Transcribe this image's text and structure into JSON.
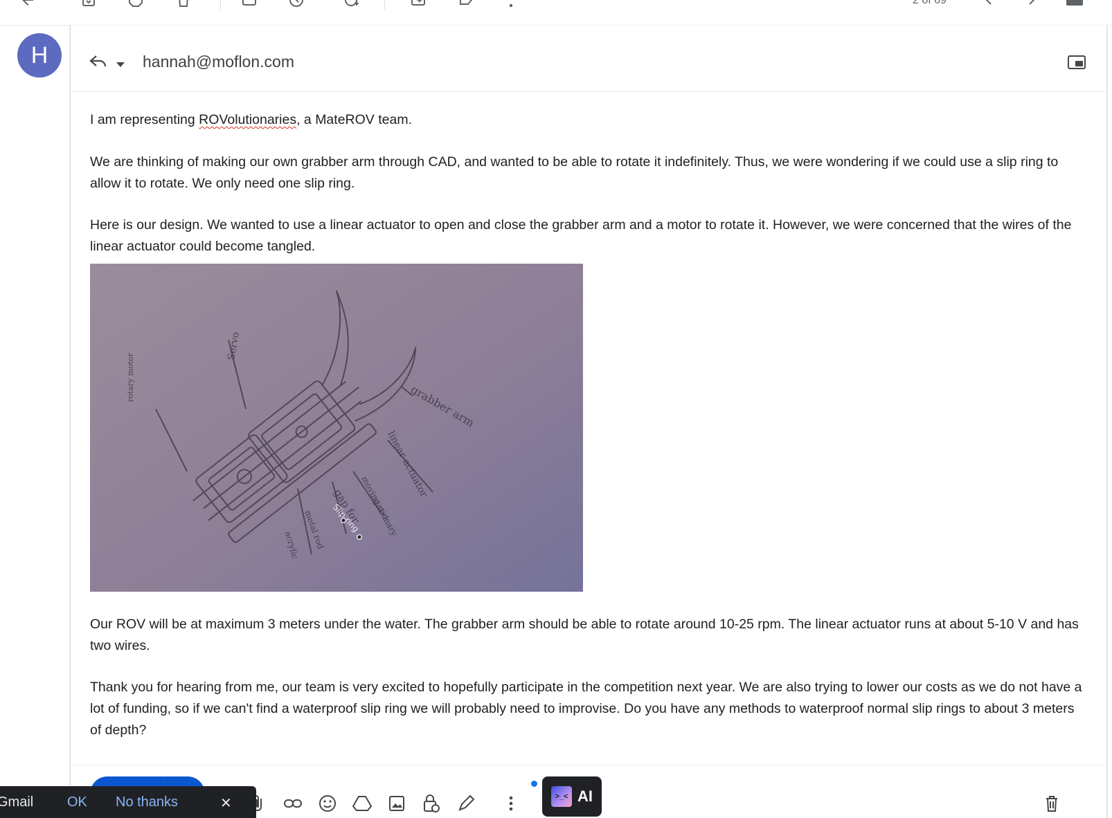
{
  "toolbar": {
    "pager_text": "2 of 69"
  },
  "sender": {
    "avatar_letter": "H"
  },
  "compose": {
    "recipient": "hannah@moflon.com",
    "p1_before": "I am representing ",
    "p1_misspelled": "ROVolutionaries",
    "p1_after": ", a MateROV team.",
    "p2": "We are thinking of making our own grabber arm through CAD, and wanted to be able to rotate it indefinitely. Thus, we were wondering if we could use a slip ring to allow it to rotate. We only need one slip ring.",
    "p3": "Here is our design. We wanted to use a linear actuator to open and close the grabber arm and a motor to rotate it. However, we were concerned that the wires of the linear actuator could become tangled.",
    "p4": "Our ROV will be at maximum 3 meters under the water. The grabber arm should be able to rotate around 10-25 rpm. The linear actuator runs at about 5-10 V and has two wires.",
    "p5": "Thank you for hearing from me, our team is very excited to hopefully participate in the competition next year. We are also trying to lower our costs as we do not have a lot of funding, so if we can't find a waterproof slip ring we will probably need to improvise. Do you have any methods to waterproof normal slip rings to about 3 meters of depth?",
    "sketch_labels": {
      "grabber": "grabber arm",
      "actuator": "linear actuator",
      "moving_rod": "moving rod",
      "stationary": "stationary",
      "gap": "gap for",
      "slip_ring": "Slip ring",
      "metal_rod": "metal rod",
      "acrylic": "acrylic",
      "servo": "Servo",
      "rotary_motor": "rotary motor"
    }
  },
  "footer": {
    "ai_label": "AI",
    "ai_logo_text": ">_<"
  },
  "snackbar": {
    "text": "Gmail",
    "ok": "OK",
    "no_thanks": "No thanks",
    "close": "✕"
  },
  "colors": {
    "accent": "#0b57d0",
    "avatar": "#5c6bc0",
    "photo_bg": "#8e8098"
  }
}
